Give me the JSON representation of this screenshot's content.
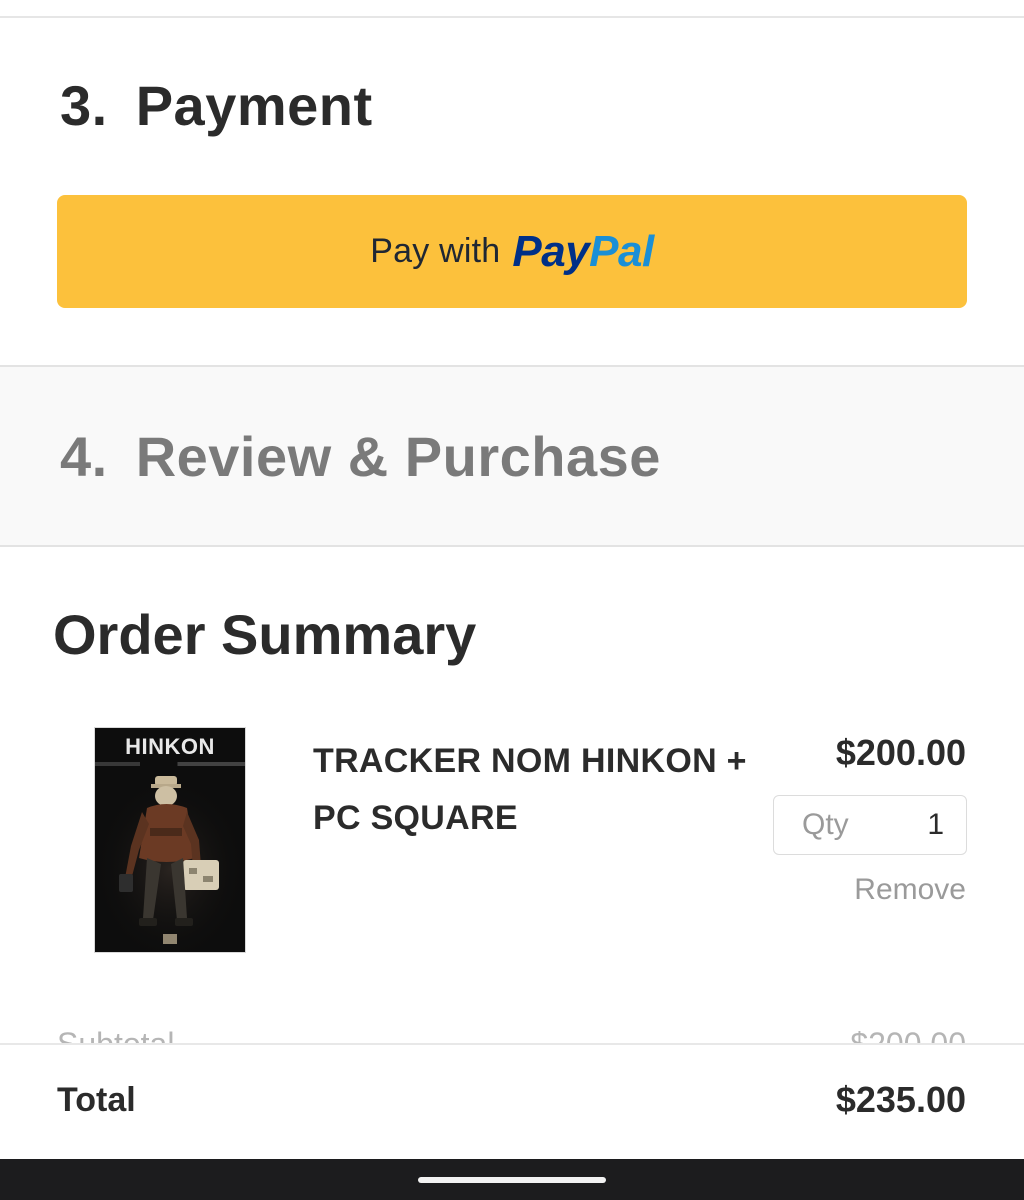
{
  "payment": {
    "step_number": "3.",
    "title": "Payment",
    "paypal_prefix": "Pay with",
    "paypal_logo_pay": "Pay",
    "paypal_logo_pal": "Pal"
  },
  "review": {
    "step_number": "4.",
    "title": "Review & Purchase"
  },
  "order_summary": {
    "title": "Order Summary",
    "items": [
      {
        "image_brand": "HINKON",
        "name": "TRACKER NOM HINKON + PC SQUARE",
        "price": "$200.00",
        "qty_label": "Qty",
        "qty_value": "1",
        "remove_label": "Remove"
      }
    ],
    "subtotal_label": "Subtotal",
    "subtotal_value": "$200.00"
  },
  "total": {
    "label": "Total",
    "value": "$235.00"
  },
  "colors": {
    "paypal_button": "#fcc13c",
    "paypal_blue_dark": "#003087",
    "paypal_blue_light": "#1a8fd6",
    "muted_text": "#9a9a9a",
    "nav_bar": "#1c1c1e"
  }
}
